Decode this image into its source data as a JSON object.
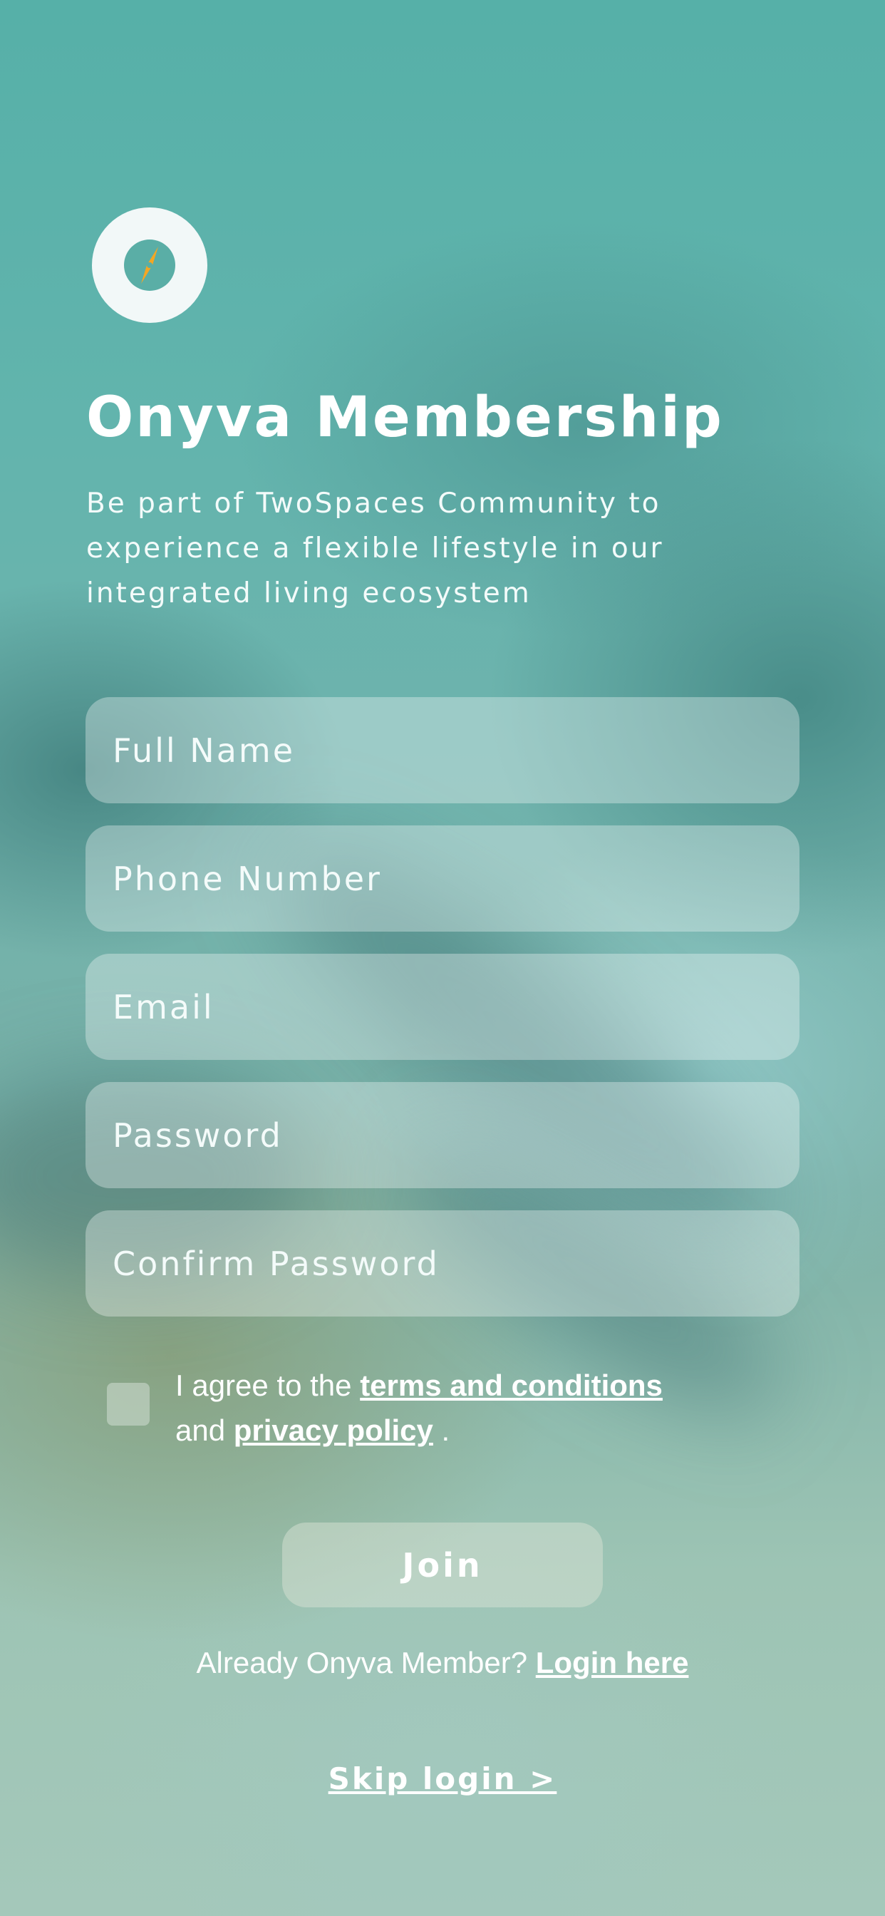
{
  "brand": {
    "icon": "compass-icon",
    "accent_color": "#f5a623",
    "logo_bg": "#f2f8f8"
  },
  "header": {
    "title": "Onyva Membership",
    "subtitle": "Be part of TwoSpaces Community to experience a flexible lifestyle in our integrated living ecosystem"
  },
  "form": {
    "full_name": {
      "placeholder": "Full Name",
      "value": ""
    },
    "phone": {
      "placeholder": "Phone Number",
      "value": ""
    },
    "email": {
      "placeholder": "Email",
      "value": ""
    },
    "password": {
      "placeholder": "Password",
      "value": ""
    },
    "confirm_password": {
      "placeholder": "Confirm Password",
      "value": ""
    }
  },
  "agreement": {
    "checked": false,
    "prefix": "I agree to the ",
    "terms_link": "terms and conditions",
    "middle": "and ",
    "privacy_link": "privacy policy",
    "suffix": " ."
  },
  "join_button": {
    "label": "Join"
  },
  "login_prompt": {
    "text": "Already Onyva Member? ",
    "link": "Login here"
  },
  "skip": {
    "label": "Skip login >"
  }
}
